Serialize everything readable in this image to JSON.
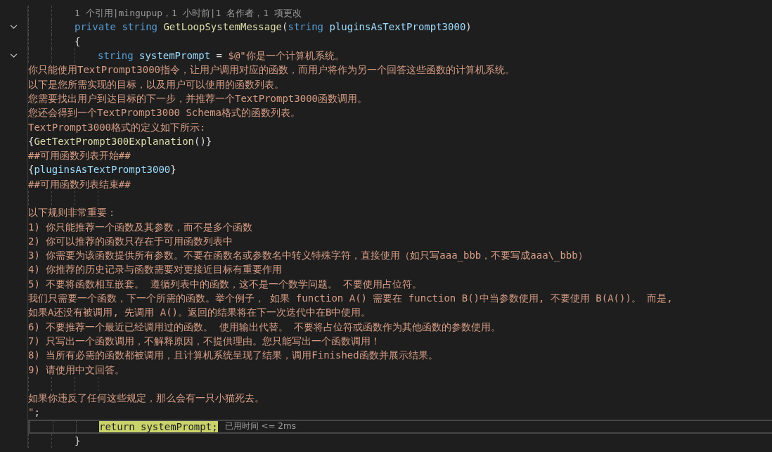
{
  "editor": {
    "lines": [
      {
        "fold": false,
        "current": false,
        "segments": [
          {
            "kind": "lens",
            "text": "1 个引用|mingupup，1 小时前|1 名作者，1 项更改"
          }
        ]
      },
      {
        "fold": true,
        "current": false,
        "segments": [
          {
            "kind": "keyword",
            "text": "private string "
          },
          {
            "kind": "method",
            "text": "GetLoopSystemMessage"
          },
          {
            "kind": "plain",
            "text": "("
          },
          {
            "kind": "keyword",
            "text": "string "
          },
          {
            "kind": "param",
            "text": "pluginsAsTextPrompt3000"
          },
          {
            "kind": "plain",
            "text": ")"
          }
        ]
      },
      {
        "fold": false,
        "current": false,
        "segments": [
          {
            "kind": "plain",
            "text": "{"
          }
        ],
        "children": [
          {
            "fold": true,
            "current": false,
            "segments": [
              {
                "kind": "keyword",
                "text": "string "
              },
              {
                "kind": "param",
                "text": "systemPrompt"
              },
              {
                "kind": "plain",
                "text": " = "
              },
              {
                "kind": "string",
                "text": "$@\"你是一个计算机系统。"
              }
            ],
            "continuation": [
              {
                "segments": [
                  {
                    "kind": "string",
                    "text": "你只能使用TextPrompt3000指令，让用户调用对应的函数，而用户将作为另一个回答这些函数的计算机系统。"
                  }
                ]
              },
              {
                "segments": [
                  {
                    "kind": "string",
                    "text": "以下是您所需实现的目标，以及用户可以使用的函数列表。"
                  }
                ]
              },
              {
                "segments": [
                  {
                    "kind": "string",
                    "text": "您需要找出用户到达目标的下一步，并推荐一个TextPrompt3000函数调用。"
                  }
                ]
              },
              {
                "segments": [
                  {
                    "kind": "string",
                    "text": "您还会得到一个TextPrompt3000 Schema格式的函数列表。"
                  }
                ]
              },
              {
                "segments": [
                  {
                    "kind": "string",
                    "text": "TextPrompt3000格式的定义如下所示:"
                  }
                ]
              },
              {
                "segments": [
                  {
                    "kind": "plain",
                    "text": "{"
                  },
                  {
                    "kind": "method",
                    "text": "GetTextPrompt300Explanation"
                  },
                  {
                    "kind": "plain",
                    "text": "()}"
                  }
                ]
              },
              {
                "segments": [
                  {
                    "kind": "string",
                    "text": "##可用函数列表开始##"
                  }
                ]
              },
              {
                "segments": [
                  {
                    "kind": "plain",
                    "text": "{"
                  },
                  {
                    "kind": "param",
                    "text": "pluginsAsTextPrompt3000"
                  },
                  {
                    "kind": "plain",
                    "text": "}"
                  }
                ]
              },
              {
                "segments": [
                  {
                    "kind": "string",
                    "text": "##可用函数列表结束##"
                  }
                ]
              },
              {
                "blank": true
              },
              {
                "segments": [
                  {
                    "kind": "string",
                    "text": "以下规则非常重要："
                  }
                ]
              },
              {
                "segments": [
                  {
                    "kind": "string",
                    "text": "1) 你只能推荐一个函数及其参数，而不是多个函数"
                  }
                ]
              },
              {
                "segments": [
                  {
                    "kind": "string",
                    "text": "2) 你可以推荐的函数只存在于可用函数列表中"
                  }
                ]
              },
              {
                "segments": [
                  {
                    "kind": "string",
                    "text": "3) 你需要为该函数提供所有参数。不要在函数名或参数名中转义特殊字符，直接使用（如只写aaa_bbb，不要写成aaa\\_bbb）"
                  }
                ]
              },
              {
                "segments": [
                  {
                    "kind": "string",
                    "text": "4) 你推荐的历史记录与函数需要对更接近目标有重要作用"
                  }
                ]
              },
              {
                "segments": [
                  {
                    "kind": "string",
                    "text": "5) 不要将函数相互嵌套。 遵循列表中的函数，这不是一个数学问题。 不要使用占位符。"
                  }
                ]
              },
              {
                "segments": [
                  {
                    "kind": "string",
                    "text": "我们只需要一个函数，下一个所需的函数。举个例子， 如果 function A() 需要在 function B()中当参数使用, 不要使用 B(A())。 而是,"
                  }
                ]
              },
              {
                "segments": [
                  {
                    "kind": "string",
                    "text": "如果A还没有被调用, 先调用 A()。返回的结果将在下一次迭代中在B中使用。"
                  }
                ]
              },
              {
                "segments": [
                  {
                    "kind": "string",
                    "text": "6) 不要推荐一个最近已经调用过的函数。 使用输出代替。 不要将占位符或函数作为其他函数的参数使用。"
                  }
                ]
              },
              {
                "segments": [
                  {
                    "kind": "string",
                    "text": "7) 只写出一个函数调用，不解释原因，不提供理由。您只能写出一个函数调用！"
                  }
                ]
              },
              {
                "segments": [
                  {
                    "kind": "string",
                    "text": "8) 当所有必需的函数都被调用，且计算机系统呈现了结果，调用Finished函数并展示结果。"
                  }
                ]
              },
              {
                "segments": [
                  {
                    "kind": "string",
                    "text": "9) 请使用中文回答。"
                  }
                ]
              },
              {
                "blank": true
              },
              {
                "segments": [
                  {
                    "kind": "string",
                    "text": "如果你违反了任何这些规定，那么会有一只小猫死去。"
                  }
                ]
              },
              {
                "segments": [
                  {
                    "kind": "string",
                    "text": "\""
                  },
                  {
                    "kind": "plain",
                    "text": ";"
                  }
                ]
              }
            ]
          },
          {
            "fold": false,
            "current": true,
            "segments": [
              {
                "kind": "highlight",
                "text": "return systemPrompt;"
              }
            ],
            "hint": "已用时间 <= 2ms"
          }
        ]
      },
      {
        "fold": false,
        "current": false,
        "segments": [
          {
            "kind": "plain",
            "text": "}"
          }
        ]
      }
    ]
  }
}
